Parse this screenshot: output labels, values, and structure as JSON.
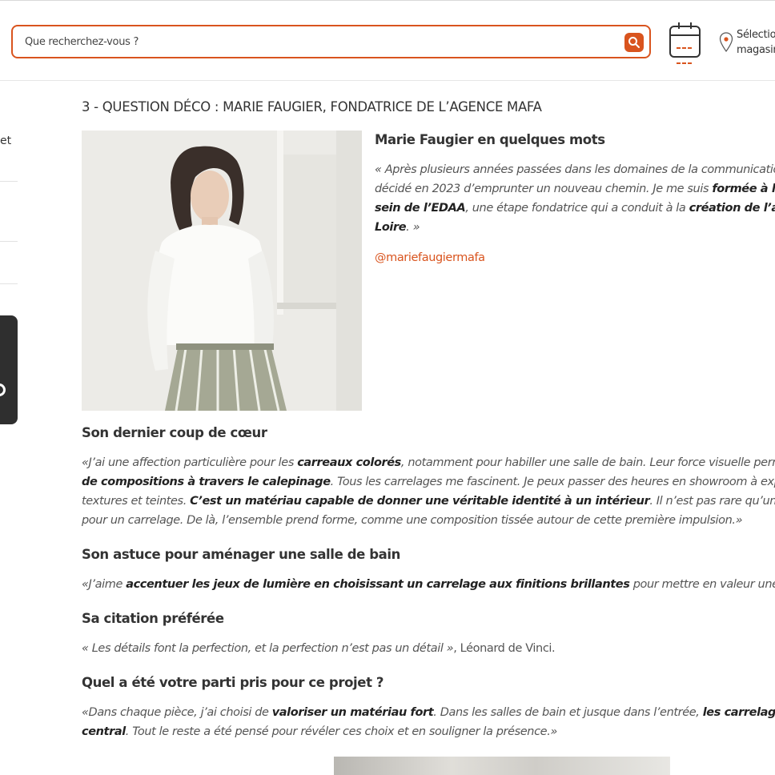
{
  "header": {
    "search": {
      "placeholder": "Que recherchez-vous ?"
    },
    "store_selector": {
      "label": "Sélectionner\nmagasin"
    }
  },
  "sidebar": {
    "fragment": "et"
  },
  "article": {
    "section_title": "3 - QUESTION DÉCO : MARIE FAUGIER, FONDATRICE DE L’AGENCE MAFA",
    "bio": {
      "heading": "Marie Faugier en quelques mots",
      "quote": [
        {
          "text": "« Après plusieurs années passées dans les domaines de la communication et de",
          "bold": false
        },
        {
          "text": "décidé en 2023 d’emprunter un nouveau chemin. Je me suis ",
          "bold": false
        },
        {
          "text": "formée à la décoration",
          "bold": true
        },
        {
          "text": "sein de l’EDAA",
          "bold": true
        },
        {
          "text": ", une étape fondatrice qui a conduit à la ",
          "bold": false
        },
        {
          "text": "création de l’agence MAFA",
          "bold": true
        },
        {
          "text": "Loire",
          "bold": true
        },
        {
          "text": ". »",
          "bold": false
        }
      ],
      "instagram": "@mariefaugiermafa"
    },
    "coup_de_coeur": {
      "heading": "Son dernier coup de cœur",
      "parts": [
        "«J’ai une affection particulière pour les ",
        "carreaux colorés",
        ", notamment pour habiller une salle de bain. Leur force visuelle permet d’imaginer",
        "de compositions à travers le calepinage",
        ". Tous les carrelages me fascinent. Je peux passer des heures en showroom à explorer les",
        "textures et teintes. ",
        "C’est un matériau capable de donner une véritable identité à un intérieur",
        ". Il n’est pas rare qu’un projet naisse",
        "pour un carrelage. De là, l’ensemble prend forme, comme une composition tissée autour de cette première impulsion.»"
      ]
    },
    "astuce": {
      "heading": "Son astuce pour aménager une salle de bain",
      "parts": [
        "«J’aime ",
        "accentuer les jeux de lumière en choisissant un carrelage aux finitions brillantes",
        " pour mettre en valeur une crédence"
      ]
    },
    "citation": {
      "heading": "Sa citation préférée",
      "quote": "« Les détails font la perfection, et la perfection n’est pas un détail »",
      "author": ", Léonard de Vinci."
    },
    "parti_pris": {
      "heading": "Quel a été votre parti pris pour ce projet ?",
      "parts": [
        "«Dans chaque pièce, j’ai choisi de ",
        "valoriser un matériau fort",
        ". Dans les salles de bain et jusque dans l’entrée, ",
        "les carrelages s’imposent",
        "central",
        ". Tout le reste a été pensé pour révéler ces choix et en souligner la présence.»"
      ]
    }
  },
  "colors": {
    "accent": "#d9541e",
    "text": "#333333"
  }
}
